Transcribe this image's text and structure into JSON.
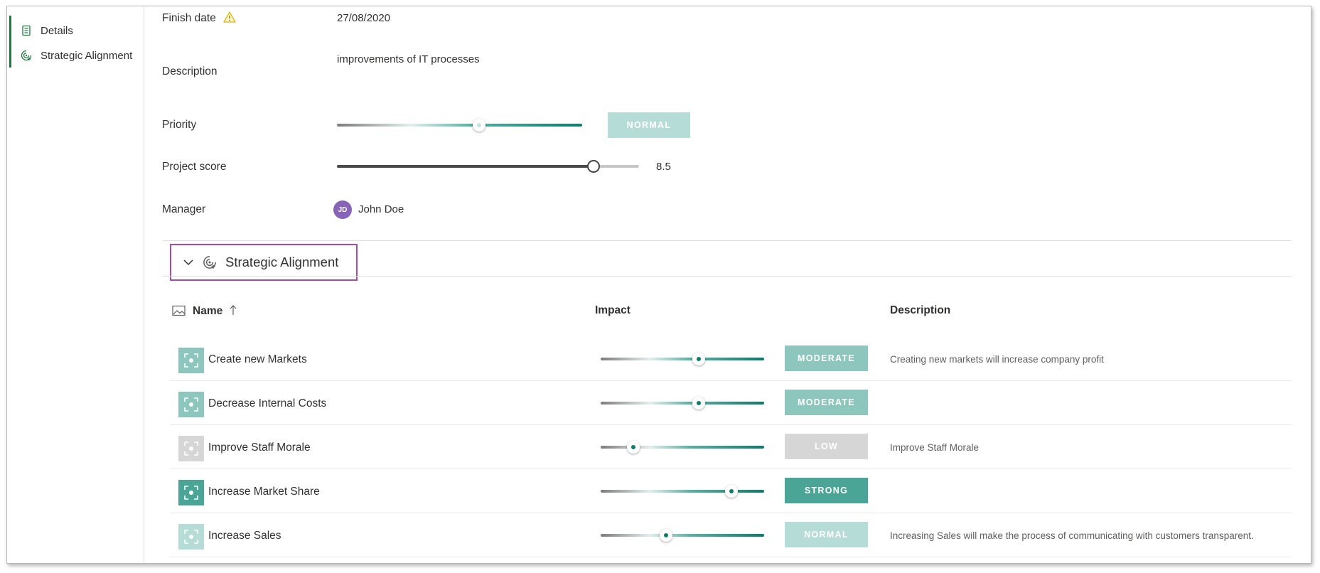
{
  "colors": {
    "nav_accent": "#1f7a3e",
    "teal_dark": "#0e7c6b",
    "badge_moderate": "#8cc6bd",
    "badge_normal": "#b5dcd6",
    "badge_low": "#d6d6d6",
    "badge_strong": "#4aa597",
    "highlight_border": "#a64ca6",
    "avatar": "#8764b8",
    "warning": "#f2c811"
  },
  "nav": {
    "items": [
      {
        "label": "Details",
        "icon": "document-icon"
      },
      {
        "label": "Strategic Alignment",
        "icon": "target-icon"
      }
    ]
  },
  "fields": {
    "finish_date": {
      "label": "Finish date",
      "value": "27/08/2020",
      "icon": "warning-icon"
    },
    "description": {
      "label": "Description",
      "value": "improvements of IT processes"
    },
    "priority": {
      "label": "Priority",
      "badge": "NORMAL",
      "level": 0.58
    },
    "project_score": {
      "label": "Project score",
      "value": "8.5",
      "fraction": 0.85
    },
    "manager": {
      "label": "Manager",
      "initials": "JD",
      "name": "John Doe"
    }
  },
  "section": {
    "title": "Strategic Alignment",
    "icon": "target-icon"
  },
  "table": {
    "columns": {
      "name": "Name",
      "impact": "Impact",
      "description": "Description"
    },
    "rows": [
      {
        "name": "Create new Markets",
        "badge": "MODERATE",
        "level": 0.6,
        "description": "Creating new markets will increase company profit",
        "color": "#8cc6bd"
      },
      {
        "name": "Decrease Internal Costs",
        "badge": "MODERATE",
        "level": 0.6,
        "description": "",
        "color": "#8cc6bd"
      },
      {
        "name": "Improve Staff Morale",
        "badge": "LOW",
        "level": 0.2,
        "description": "Improve Staff Morale",
        "color": "#d6d6d6"
      },
      {
        "name": "Increase Market Share",
        "badge": "STRONG",
        "level": 0.8,
        "description": "",
        "color": "#4aa597"
      },
      {
        "name": "Increase Sales",
        "badge": "NORMAL",
        "level": 0.4,
        "description": "Increasing Sales will make the process of communicating with customers transparent.",
        "color": "#b5dcd6"
      }
    ]
  }
}
